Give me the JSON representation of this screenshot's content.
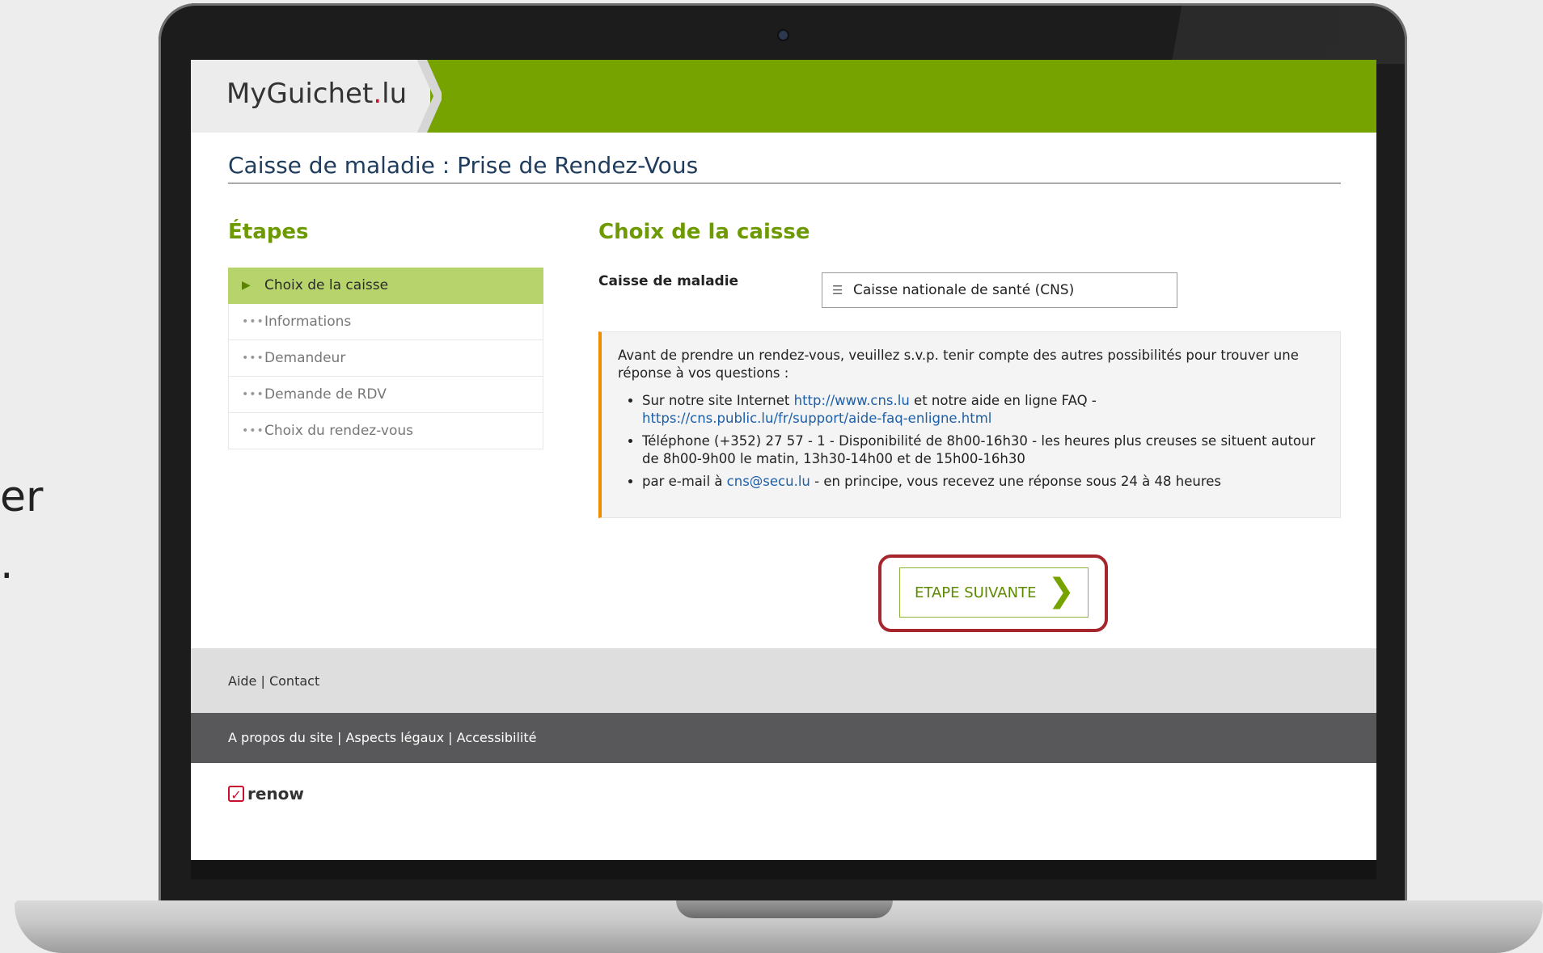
{
  "background": {
    "frag1": "er",
    "frag2": "."
  },
  "header": {
    "logo_prefix": "My",
    "logo_main": "Guichet",
    "logo_dot": ".",
    "logo_suffix": "lu"
  },
  "page": {
    "title": "Caisse de maladie : Prise de Rendez-Vous"
  },
  "steps": {
    "heading": "Étapes",
    "items": [
      {
        "label": "Choix de la caisse",
        "active": true
      },
      {
        "label": "Informations",
        "active": false
      },
      {
        "label": "Demandeur",
        "active": false
      },
      {
        "label": "Demande de RDV",
        "active": false
      },
      {
        "label": "Choix du rendez-vous",
        "active": false
      }
    ]
  },
  "form": {
    "heading": "Choix de la caisse",
    "field_label": "Caisse de maladie",
    "select_value": "Caisse nationale de santé (CNS)"
  },
  "info": {
    "intro": "Avant de prendre un rendez-vous, veuillez s.v.p. tenir compte des autres possibilités pour trouver une réponse à vos questions :",
    "b1_pre": "Sur notre site Internet ",
    "b1_link1": "http://www.cns.lu",
    "b1_mid": " et notre aide en ligne FAQ - ",
    "b1_link2": "https://cns.public.lu/fr/support/aide-faq-enligne.html",
    "b2": "Téléphone (+352) 27 57 - 1 - Disponibilité de 8h00-16h30 - les heures plus creuses se situent autour de 8h00-9h00 le matin, 13h30-14h00 et de 15h00-16h30",
    "b3_pre": "par e-mail à ",
    "b3_link": "cns@secu.lu",
    "b3_post": " - en principe, vous recevez une réponse sous 24 à 48 heures"
  },
  "actions": {
    "next_label": "ETAPE SUIVANTE"
  },
  "footer": {
    "aide": "Aide",
    "contact": "Contact",
    "apropos": "A propos du site",
    "legal": "Aspects légaux",
    "access": "Accessibilité",
    "brand": "renow"
  },
  "colors": {
    "accent": "#77a300",
    "highlight": "#a5262d",
    "info_border": "#f08c00",
    "link": "#1d5fa8"
  }
}
